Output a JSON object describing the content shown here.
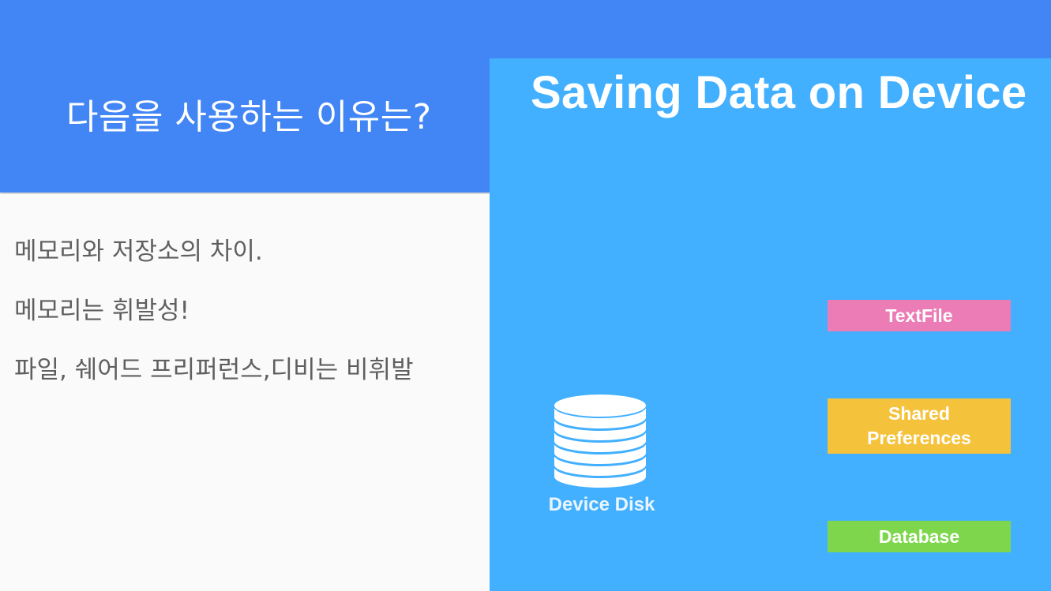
{
  "slide": {
    "title": "다음을 사용하는 이유는?",
    "bullets": [
      "메모리와 저장소의 차이.",
      "메모리는 휘발성!",
      "파일, 쉐어드 프리퍼런스,디비는  비휘발"
    ]
  },
  "image": {
    "title": "Saving Data on Device",
    "disk_label": "Device Disk",
    "storage_options": [
      {
        "label": "TextFile",
        "color": "#ec7cb5"
      },
      {
        "label": "Shared\nPreferences",
        "color": "#f5c23c"
      },
      {
        "label": "Database",
        "color": "#7dd64c"
      }
    ]
  },
  "colors": {
    "header": "#4285f4",
    "image_background": "#42b0ff",
    "body_text": "#5f5f5f"
  },
  "icons": [
    "database-icon"
  ]
}
